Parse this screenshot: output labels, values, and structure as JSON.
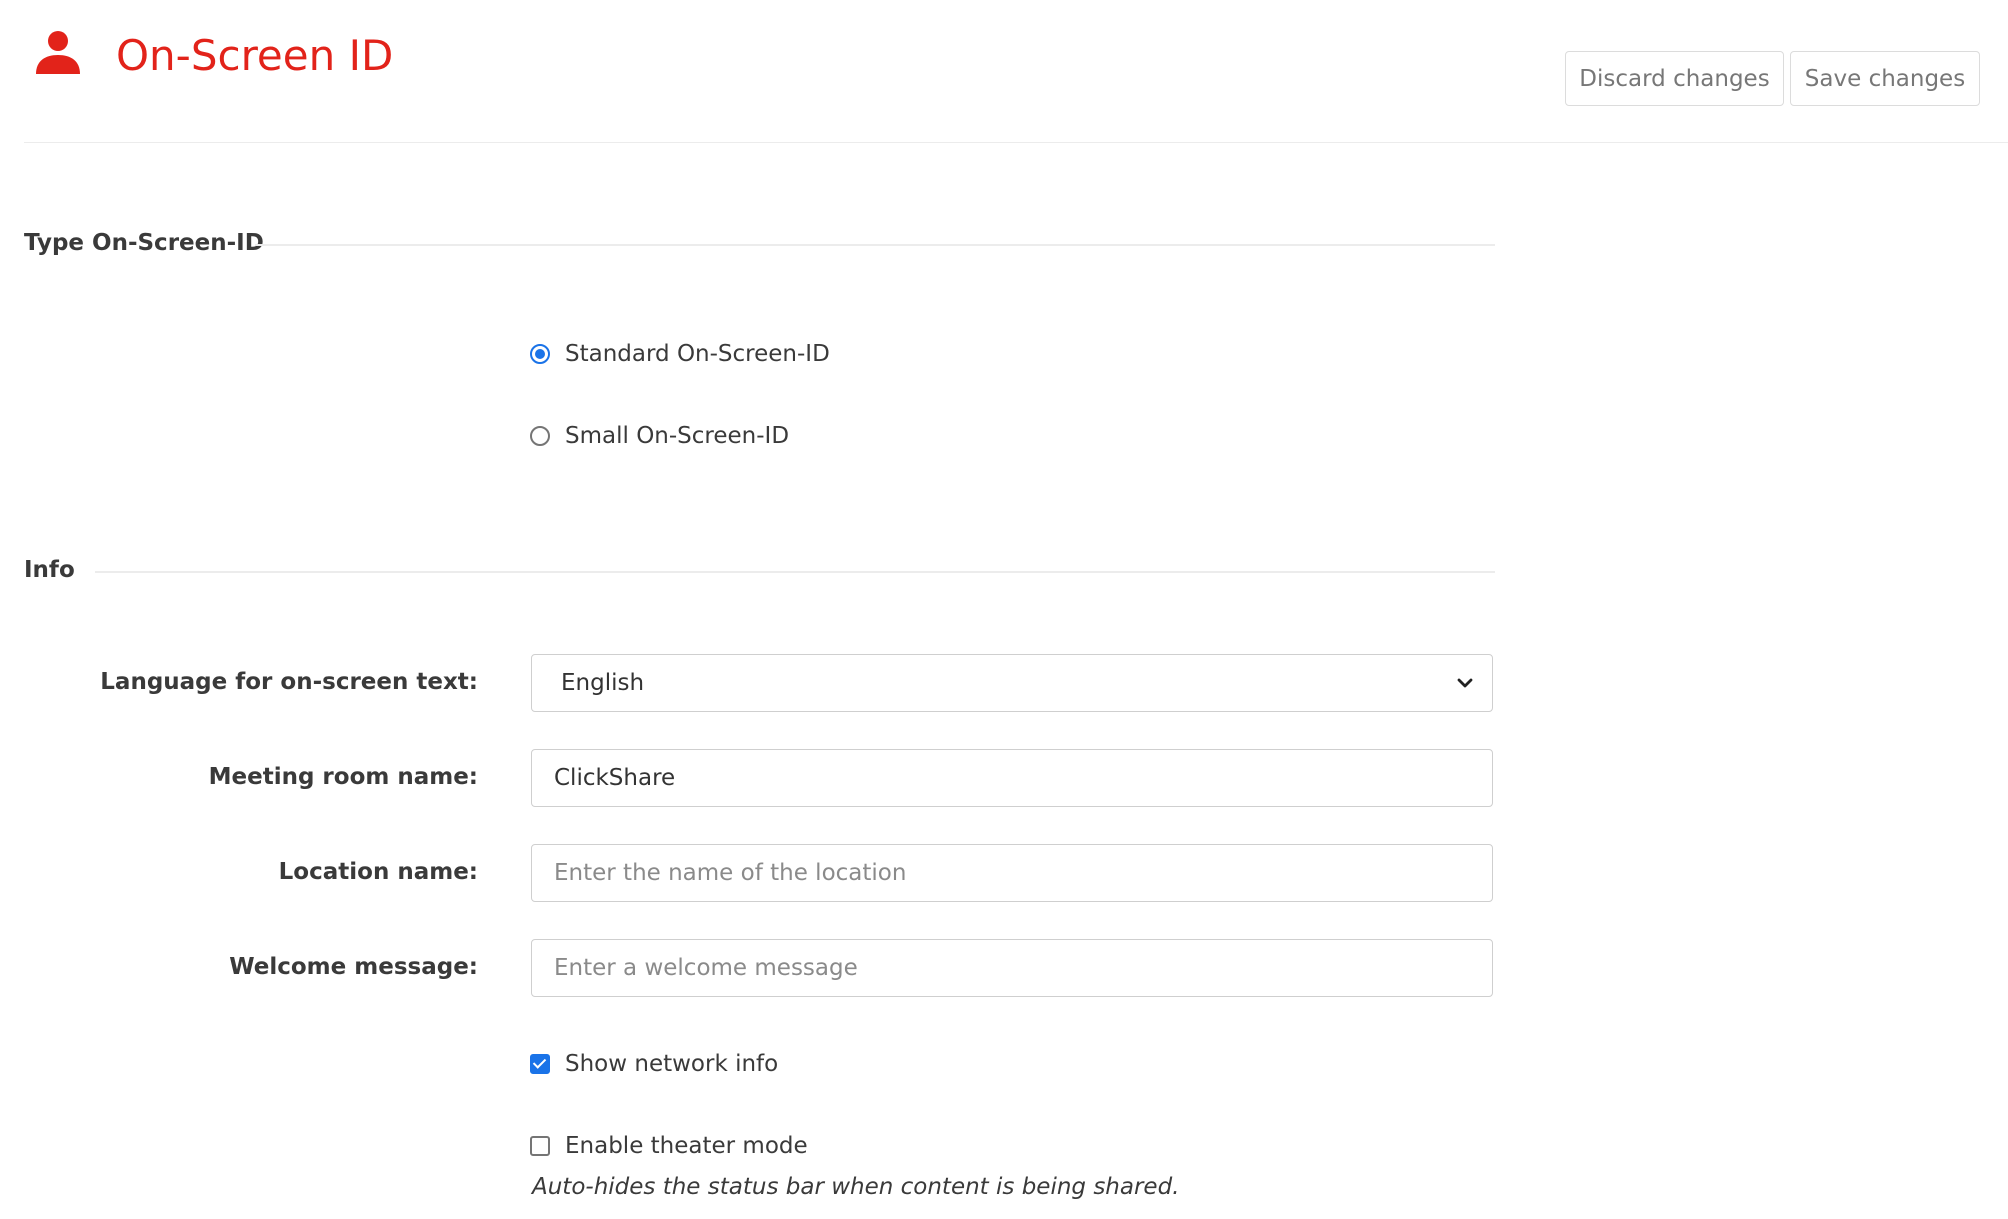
{
  "header": {
    "title": "On-Screen ID",
    "icon": "user-icon",
    "accent_color": "#e2231a",
    "discard_label": "Discard changes",
    "save_label": "Save changes"
  },
  "type_section": {
    "title": "Type On-Screen-ID",
    "options": [
      {
        "label": "Standard On-Screen-ID",
        "selected": true
      },
      {
        "label": "Small On-Screen-ID",
        "selected": false
      }
    ]
  },
  "info_section": {
    "title": "Info",
    "language": {
      "label": "Language for on-screen text:",
      "value": "English"
    },
    "meeting_room": {
      "label": "Meeting room name:",
      "value": "ClickShare",
      "placeholder": ""
    },
    "location": {
      "label": "Location name:",
      "value": "",
      "placeholder": "Enter the name of the location"
    },
    "welcome": {
      "label": "Welcome message:",
      "value": "",
      "placeholder": "Enter a welcome message"
    },
    "show_network": {
      "label": "Show network info",
      "checked": true
    },
    "theater_mode": {
      "label": "Enable theater mode",
      "checked": false,
      "help": "Auto-hides the status bar when content is being shared."
    }
  },
  "colors": {
    "checked": "#1a73e8"
  }
}
